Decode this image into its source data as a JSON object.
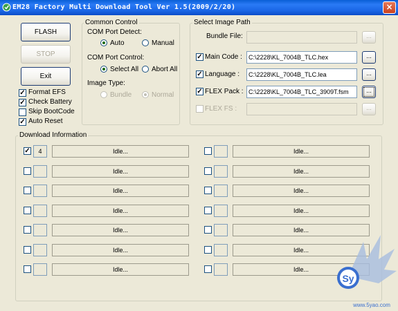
{
  "window": {
    "title": "EM28 Factory Multi Download Tool Ver 1.5(2009/2/20)",
    "close_glyph": "×"
  },
  "buttons": {
    "flash": "FLASH",
    "stop": "STOP",
    "exit": "Exit"
  },
  "options": [
    {
      "label": "Format EFS",
      "checked": true
    },
    {
      "label": "Check Battery",
      "checked": true
    },
    {
      "label": "Skip BootCode",
      "checked": false
    },
    {
      "label": "Auto Reset",
      "checked": true
    }
  ],
  "common": {
    "legend": "Common Control",
    "port_detect_label": "COM Port Detect:",
    "auto": "Auto",
    "manual": "Manual",
    "port_control_label": "COM Port Control:",
    "select_all": "Select All",
    "abort_all": "Abort All",
    "image_type_label": "Image Type:",
    "bundle": "Bundle",
    "normal": "Normal"
  },
  "image_path": {
    "legend": "Select Image Path",
    "bundle_label": "Bundle File:",
    "bundle_value": "",
    "rows": [
      {
        "label": "Main Code :",
        "value": "C:\\2228\\KL_7004B_TLC.hex",
        "checked": true
      },
      {
        "label": "Language :",
        "value": "C:\\2228\\KL_7004B_TLC.lea",
        "checked": true
      },
      {
        "label": "FLEX Pack :",
        "value": "C:\\2228\\KL_7004B_TLC_3909T.fsm",
        "checked": true
      },
      {
        "label": "FLEX FS :",
        "value": "",
        "checked": false
      }
    ],
    "browse": "...",
    "check_glyph": "✓"
  },
  "download": {
    "legend": "Download Information",
    "status": "Idle...",
    "left_ports": [
      "4",
      "",
      "",
      "",
      "",
      "",
      ""
    ],
    "left_checked": [
      true,
      false,
      false,
      false,
      false,
      false,
      false
    ],
    "right_ports": [
      "",
      "",
      "",
      "",
      "",
      "",
      ""
    ]
  },
  "watermark": {
    "text": "Sy",
    "url": "www.5yao.com"
  },
  "colors": {
    "titlebar": "#0a5fd6",
    "face": "#ece9d8",
    "check": "#1d6a12"
  }
}
